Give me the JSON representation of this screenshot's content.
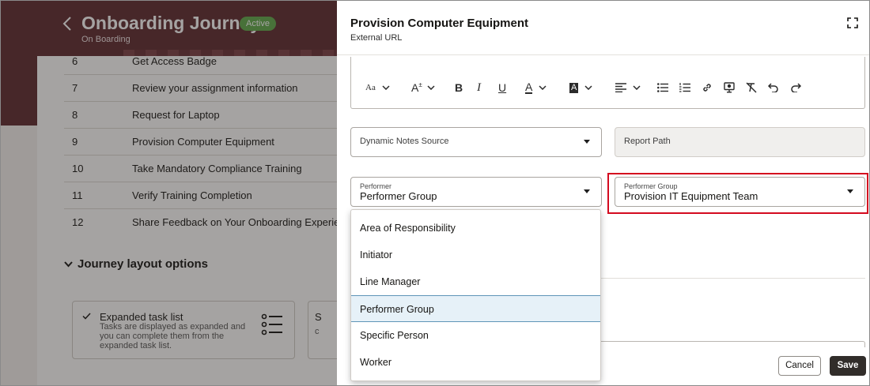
{
  "page": {
    "title": "Onboarding Journey",
    "status_badge": "Active",
    "subtitle": "On Boarding",
    "tasks": [
      {
        "num": "6",
        "name": "Get Access Badge"
      },
      {
        "num": "7",
        "name": "Review your assignment information"
      },
      {
        "num": "8",
        "name": "Request for Laptop"
      },
      {
        "num": "9",
        "name": "Provision Computer Equipment"
      },
      {
        "num": "10",
        "name": "Take Mandatory Compliance Training"
      },
      {
        "num": "11",
        "name": "Verify Training Completion"
      },
      {
        "num": "12",
        "name": "Share Feedback on Your Onboarding Experience"
      }
    ],
    "layout_section": {
      "heading": "Journey layout options",
      "option1_title": "Expanded task list",
      "option1_desc": "Tasks are displayed as expanded and you can complete them from the expanded task list.",
      "option2_title": "S",
      "option2_desc": "c"
    }
  },
  "drawer": {
    "title": "Provision Computer Equipment",
    "subtitle": "External URL",
    "toolbar": {
      "font_size": "Aa",
      "text_size": "A",
      "bold": "B",
      "italic": "I",
      "underline": "U",
      "font_color": "A",
      "highlight": "A"
    },
    "dynamic_notes_source": {
      "placeholder": "Dynamic Notes Source"
    },
    "report_path": {
      "placeholder": "Report Path"
    },
    "performer": {
      "label": "Performer",
      "value": "Performer Group"
    },
    "performer_group": {
      "label": "Performer Group",
      "value": "Provision IT Equipment Team"
    },
    "performer_options": [
      {
        "label": "Area of Responsibility",
        "selected": false
      },
      {
        "label": "Initiator",
        "selected": false
      },
      {
        "label": "Line Manager",
        "selected": false
      },
      {
        "label": "Performer Group",
        "selected": true
      },
      {
        "label": "Specific Person",
        "selected": false
      },
      {
        "label": "Worker",
        "selected": false
      }
    ],
    "cancel_label": "Cancel",
    "save_label": "Save"
  },
  "colors": {
    "header_bg": "#5d2a30",
    "badge": "#5fa94a",
    "highlight_box": "#d40a1f",
    "selected_option": "#e6f1f8",
    "save_button": "#312d2a"
  }
}
